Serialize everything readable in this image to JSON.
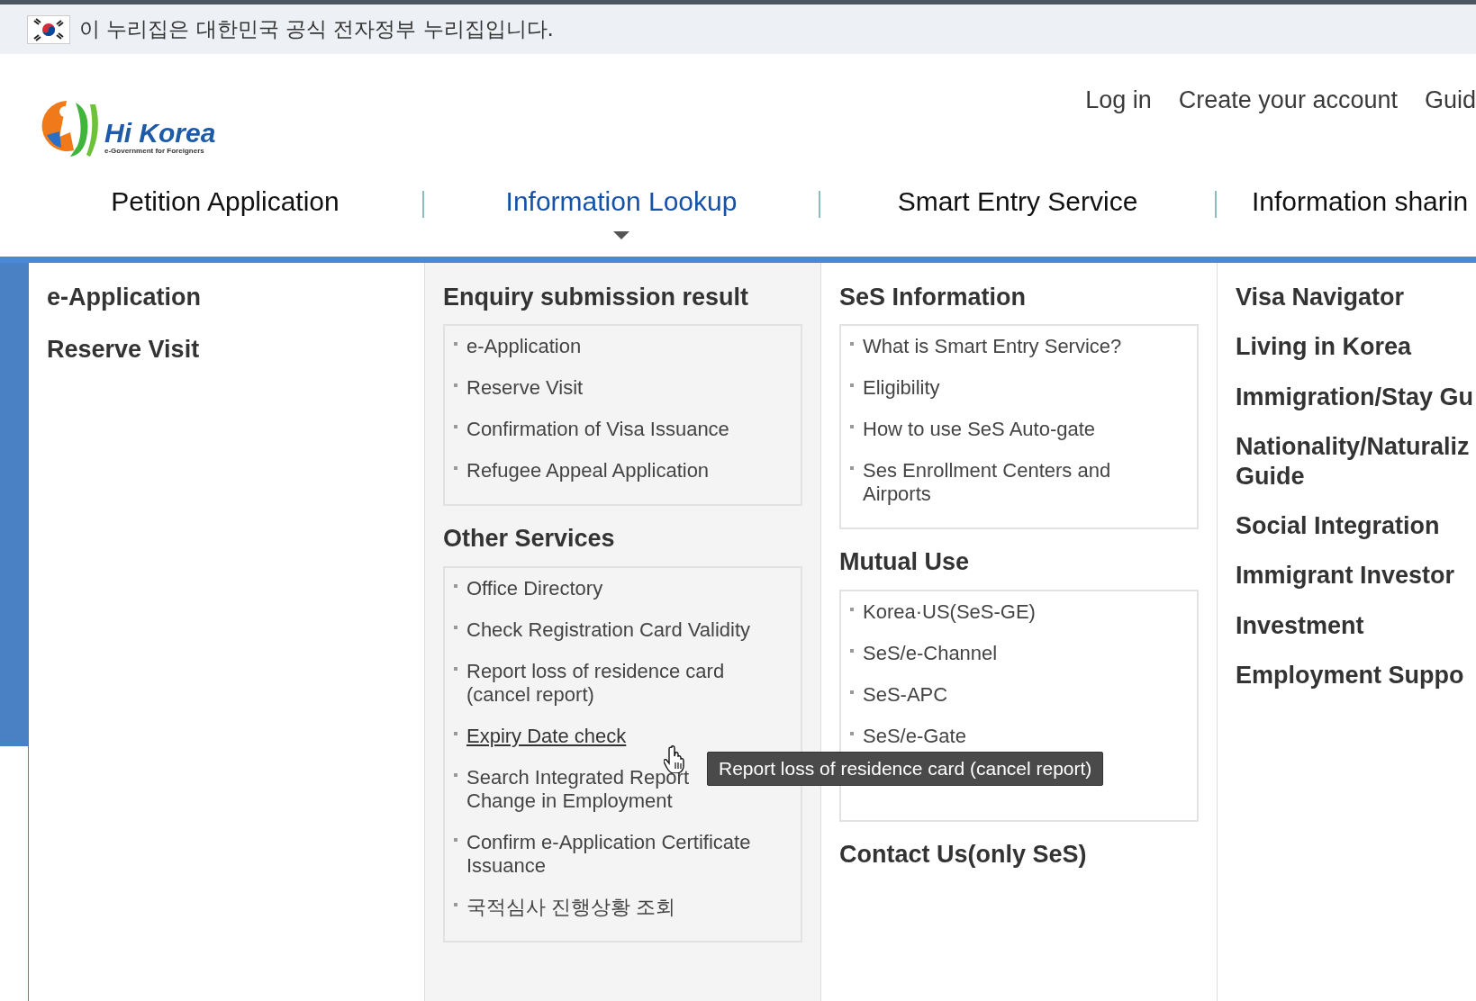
{
  "gov_banner": {
    "text": "이 누리집은 대한민국 공식 전자정부 누리집입니다."
  },
  "logo": {
    "name": "Hi Korea",
    "tagline": "e-Government for Foreigners"
  },
  "top_links": [
    "Log in",
    "Create your account",
    "Guid"
  ],
  "nav": [
    {
      "label": "Petition Application",
      "selected": false
    },
    {
      "label": "Information Lookup",
      "selected": true
    },
    {
      "label": "Smart Entry Service",
      "selected": false
    },
    {
      "label": "Information sharin",
      "selected": false
    }
  ],
  "columns": [
    {
      "groups": [
        {
          "heading": "e-Application"
        },
        {
          "heading": "Reserve Visit"
        }
      ]
    },
    {
      "groups": [
        {
          "heading": "Enquiry submission result",
          "items": [
            {
              "text": "e-Application",
              "hovered": false
            },
            {
              "text": "Reserve Visit",
              "hovered": false
            },
            {
              "text": "Confirmation of Visa Issuance",
              "hovered": false
            },
            {
              "text": "Refugee Appeal Application",
              "hovered": false
            }
          ]
        },
        {
          "heading": "Other Services",
          "items": [
            {
              "text": "Office Directory",
              "hovered": false
            },
            {
              "text": "Check Registration Card Validity",
              "hovered": false
            },
            {
              "text": "Report loss of residence card (cancel report)",
              "hovered": false
            },
            {
              "text": "Expiry Date check",
              "hovered": true
            },
            {
              "text": "Search Integrated Report\nChange in Employment",
              "hovered": false
            },
            {
              "text": "Confirm e-Application Certificate Issuance",
              "hovered": false
            },
            {
              "text": "국적심사 진행상황 조회",
              "hovered": false
            }
          ]
        }
      ]
    },
    {
      "groups": [
        {
          "heading": "SeS Information",
          "items": [
            {
              "text": "What is Smart Entry Service?",
              "hovered": false
            },
            {
              "text": "Eligibility",
              "hovered": false
            },
            {
              "text": "How to use SeS Auto-gate",
              "hovered": false
            },
            {
              "text": "Ses Enrollment Centers and Airports",
              "hovered": false
            }
          ]
        },
        {
          "heading": "Mutual Use",
          "items": [
            {
              "text": "Korea·US(SeS-GE)",
              "hovered": false
            },
            {
              "text": "SeS/e-Channel",
              "hovered": false
            },
            {
              "text": "SeS-APC",
              "hovered": false
            },
            {
              "text": "SeS/e-Gate",
              "hovered": false
            }
          ]
        },
        {
          "heading": "Contact Us(only SeS)"
        }
      ]
    },
    {
      "groups": [
        {
          "heading": "Visa Navigator"
        },
        {
          "heading": "Living in Korea"
        },
        {
          "heading": "Immigration/Stay Gu"
        },
        {
          "heading": "Nationality/Naturaliz\nGuide"
        },
        {
          "heading": "Social Integration"
        },
        {
          "heading": "Immigrant Investor"
        },
        {
          "heading": "Investment"
        },
        {
          "heading": "Employment Suppo"
        }
      ]
    }
  ],
  "tooltip": {
    "text": "Report loss of residence card (cancel report)"
  }
}
